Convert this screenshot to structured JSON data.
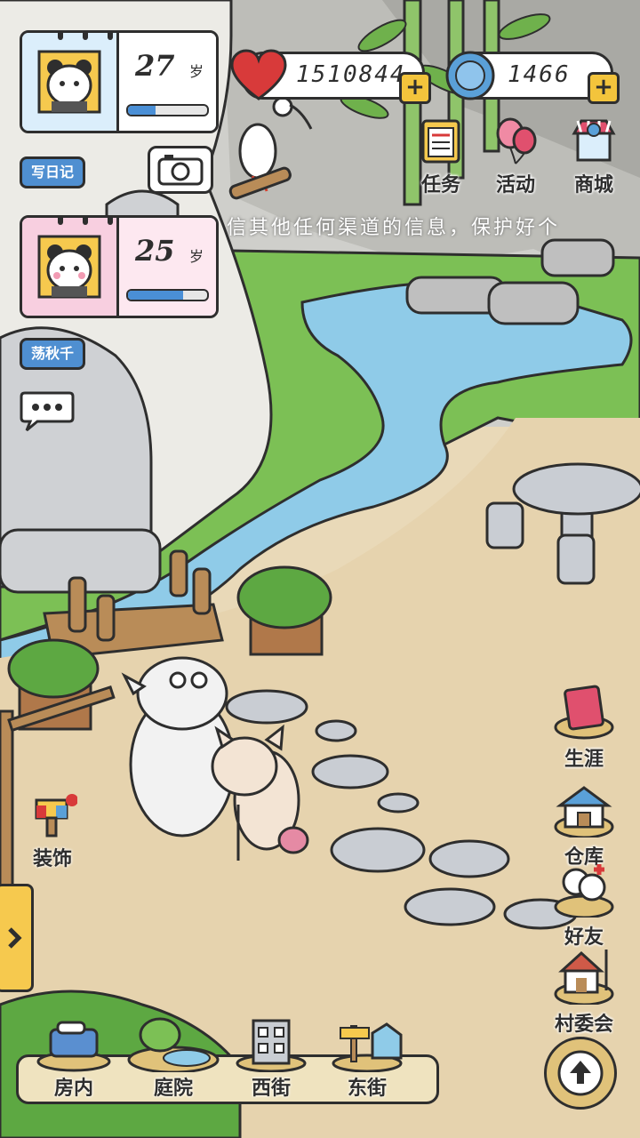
{
  "player_cards": [
    {
      "age": "27",
      "unit": "岁",
      "progress": 0.35
    },
    {
      "age": "25",
      "unit": "岁",
      "progress": 0.7
    }
  ],
  "buttons": {
    "diary": "写日记",
    "swing": "荡秋千"
  },
  "currencies": {
    "hearts": "1510844",
    "coins": "1466"
  },
  "top_menu": [
    "任务",
    "活动",
    "商城"
  ],
  "marquee_text": "信其他任何渠道的信息，保护好个",
  "side_menu": [
    "生涯",
    "仓库",
    "好友",
    "村委会"
  ],
  "decorate_label": "装饰",
  "bottom_nav": [
    "房内",
    "庭院",
    "西街",
    "东街"
  ],
  "colors": {
    "accent_blue": "#4f8fd1",
    "card_blue": "#dbeefb",
    "card_pink": "#f8cfe0",
    "grass": "#7cc055",
    "water": "#8fcbe8",
    "path": "#e6d3ae"
  }
}
